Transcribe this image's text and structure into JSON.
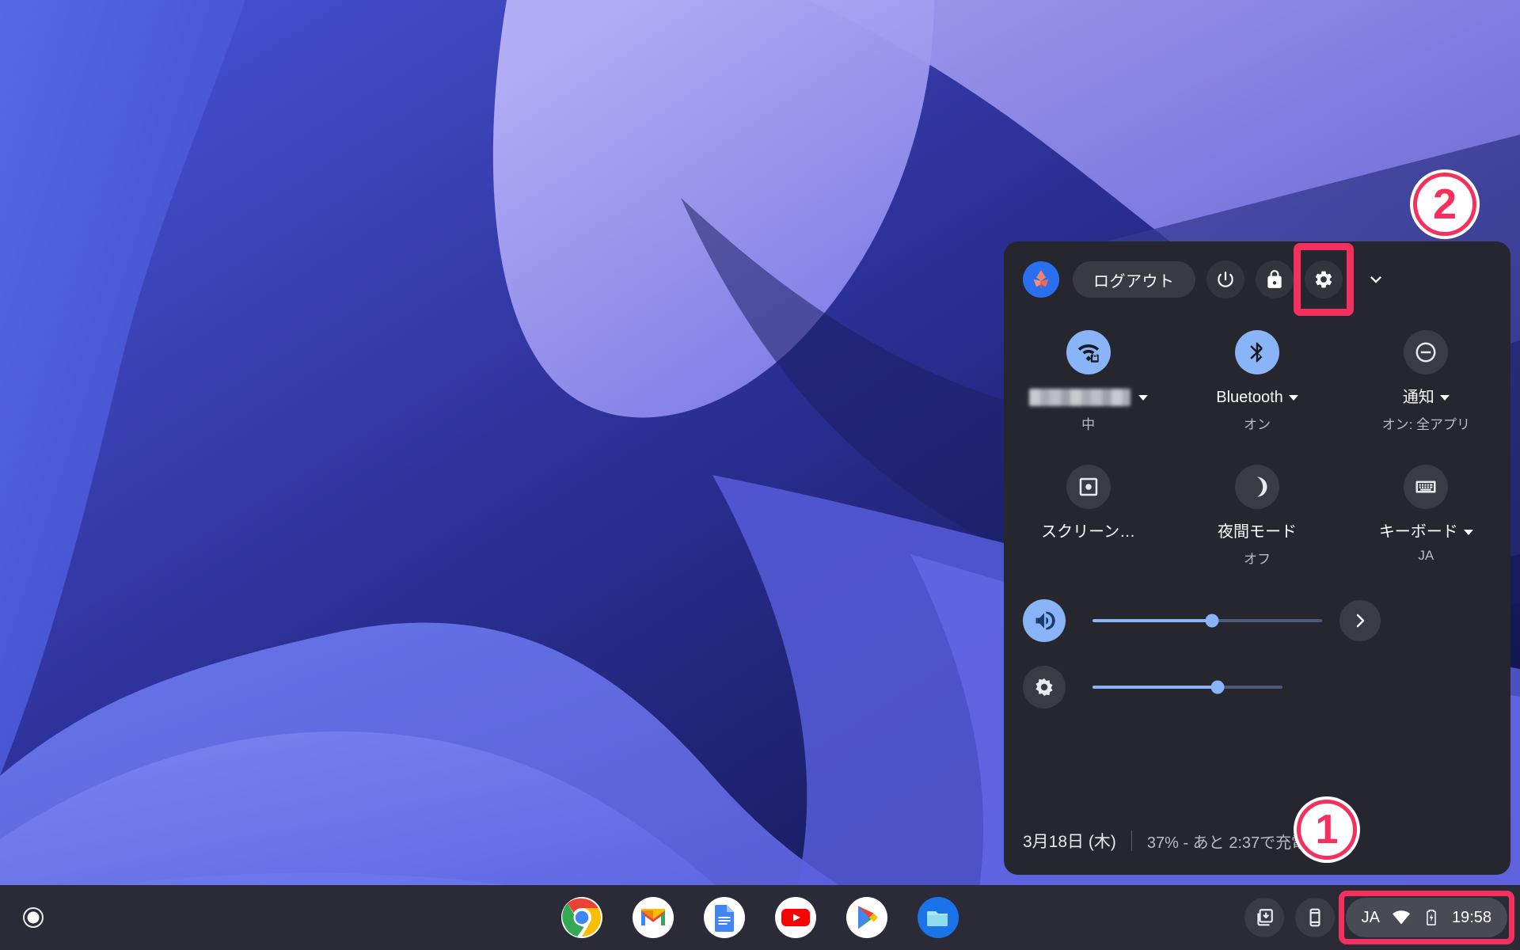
{
  "desktop": {
    "wallpaper_name": "chromeos-abstract-purple-waves",
    "colors": {
      "deep_navy": "#0b1038",
      "indigo": "#3d3f9e",
      "periwinkle": "#6c6ceb",
      "lavender": "#9a95f0",
      "soft_blue": "#5470e8",
      "panel_bg": "#26262e",
      "shelf_bg": "#2b2b37",
      "accent_blue": "#8ab4f8",
      "highlight_pink": "#f5305e"
    }
  },
  "quick_settings": {
    "header": {
      "avatar_name": "butterfly-avatar",
      "sign_out_label": "ログアウト",
      "power_icon": "power-icon",
      "lock_icon": "lock-icon",
      "settings_icon": "gear-icon",
      "collapse_icon": "chevron-down-icon"
    },
    "tiles": [
      {
        "id": "network",
        "icon": "wifi-locked-icon",
        "label": "",
        "label_redacted": true,
        "sublabel": "中",
        "has_caret": true,
        "active": true
      },
      {
        "id": "bluetooth",
        "icon": "bluetooth-icon",
        "label": "Bluetooth",
        "label_redacted": false,
        "sublabel": "オン",
        "has_caret": true,
        "active": true
      },
      {
        "id": "notifications",
        "icon": "do-not-disturb-icon",
        "label": "通知",
        "label_redacted": false,
        "sublabel": "オン: 全アプリ",
        "has_caret": true,
        "active": false
      },
      {
        "id": "screen_capture",
        "icon": "screen-capture-icon",
        "label": "スクリーン…",
        "label_redacted": false,
        "sublabel": "",
        "has_caret": false,
        "active": false
      },
      {
        "id": "night_light",
        "icon": "moon-icon",
        "label": "夜間モード",
        "label_redacted": false,
        "sublabel": "オフ",
        "has_caret": false,
        "active": false
      },
      {
        "id": "keyboard",
        "icon": "keyboard-icon",
        "label": "キーボード",
        "label_redacted": false,
        "sublabel": "JA",
        "has_caret": true,
        "active": false
      }
    ],
    "sliders": [
      {
        "id": "volume",
        "icon": "volume-icon",
        "value": 52,
        "active": true,
        "has_next_button": true,
        "next_icon": "chevron-right-icon"
      },
      {
        "id": "brightness",
        "icon": "brightness-icon",
        "value": 66,
        "active": false,
        "has_next_button": false,
        "next_icon": ""
      }
    ],
    "footer": {
      "date": "3月18日 (木)",
      "battery": "37% - あと 2:37で充電完了"
    }
  },
  "shelf": {
    "launcher_icon": "launcher-circle-icon",
    "apps": [
      {
        "name": "Chrome",
        "icon": "chrome-icon"
      },
      {
        "name": "Gmail",
        "icon": "gmail-icon"
      },
      {
        "name": "Google Docs",
        "icon": "docs-icon"
      },
      {
        "name": "YouTube",
        "icon": "youtube-icon"
      },
      {
        "name": "Google Play",
        "icon": "play-store-icon"
      },
      {
        "name": "Files",
        "icon": "files-icon"
      }
    ],
    "tray_buttons": [
      {
        "name": "screen-capture",
        "icon": "screen-capture-tray-icon"
      },
      {
        "name": "phone-hub",
        "icon": "phone-hub-icon"
      }
    ],
    "status_area": {
      "ime_label": "JA",
      "wifi_icon": "wifi-icon",
      "battery_icon": "battery-charging-icon",
      "clock": "19:58"
    }
  },
  "annotations": {
    "markers": [
      {
        "id": "marker-1",
        "label": "①",
        "glyph": "1"
      },
      {
        "id": "marker-2",
        "label": "②",
        "glyph": "2"
      }
    ],
    "highlight_boxes": [
      {
        "id": "settings-gear-highlight",
        "target": "gear-icon"
      },
      {
        "id": "status-area-highlight",
        "target": "status-area"
      }
    ]
  }
}
